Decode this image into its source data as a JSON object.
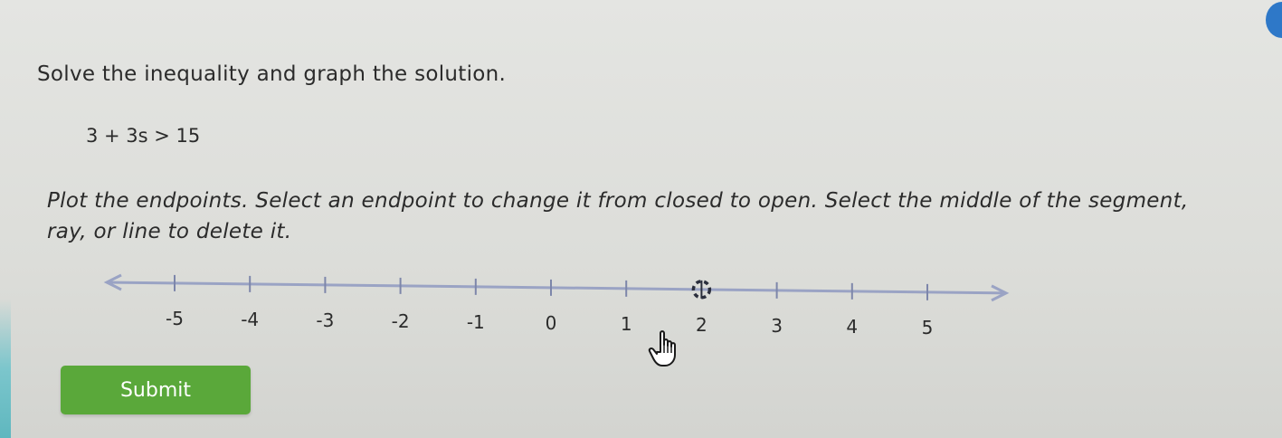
{
  "problem": {
    "instruction": "Solve the inequality and graph the solution.",
    "equation": "3 + 3s > 15",
    "directions": "Plot the endpoints. Select an endpoint to change it from closed to open. Select the middle of the segment, ray, or line to delete it."
  },
  "number_line": {
    "min": -5,
    "max": 5,
    "ticks": [
      "-5",
      "-4",
      "-3",
      "-2",
      "-1",
      "0",
      "1",
      "2",
      "3",
      "4",
      "5"
    ],
    "open_endpoint": 2,
    "line_color": "#9aa3c4"
  },
  "submit": {
    "label": "Submit",
    "color": "#5aa83a"
  },
  "cursor": {
    "icon": "hand-pointer-icon"
  }
}
